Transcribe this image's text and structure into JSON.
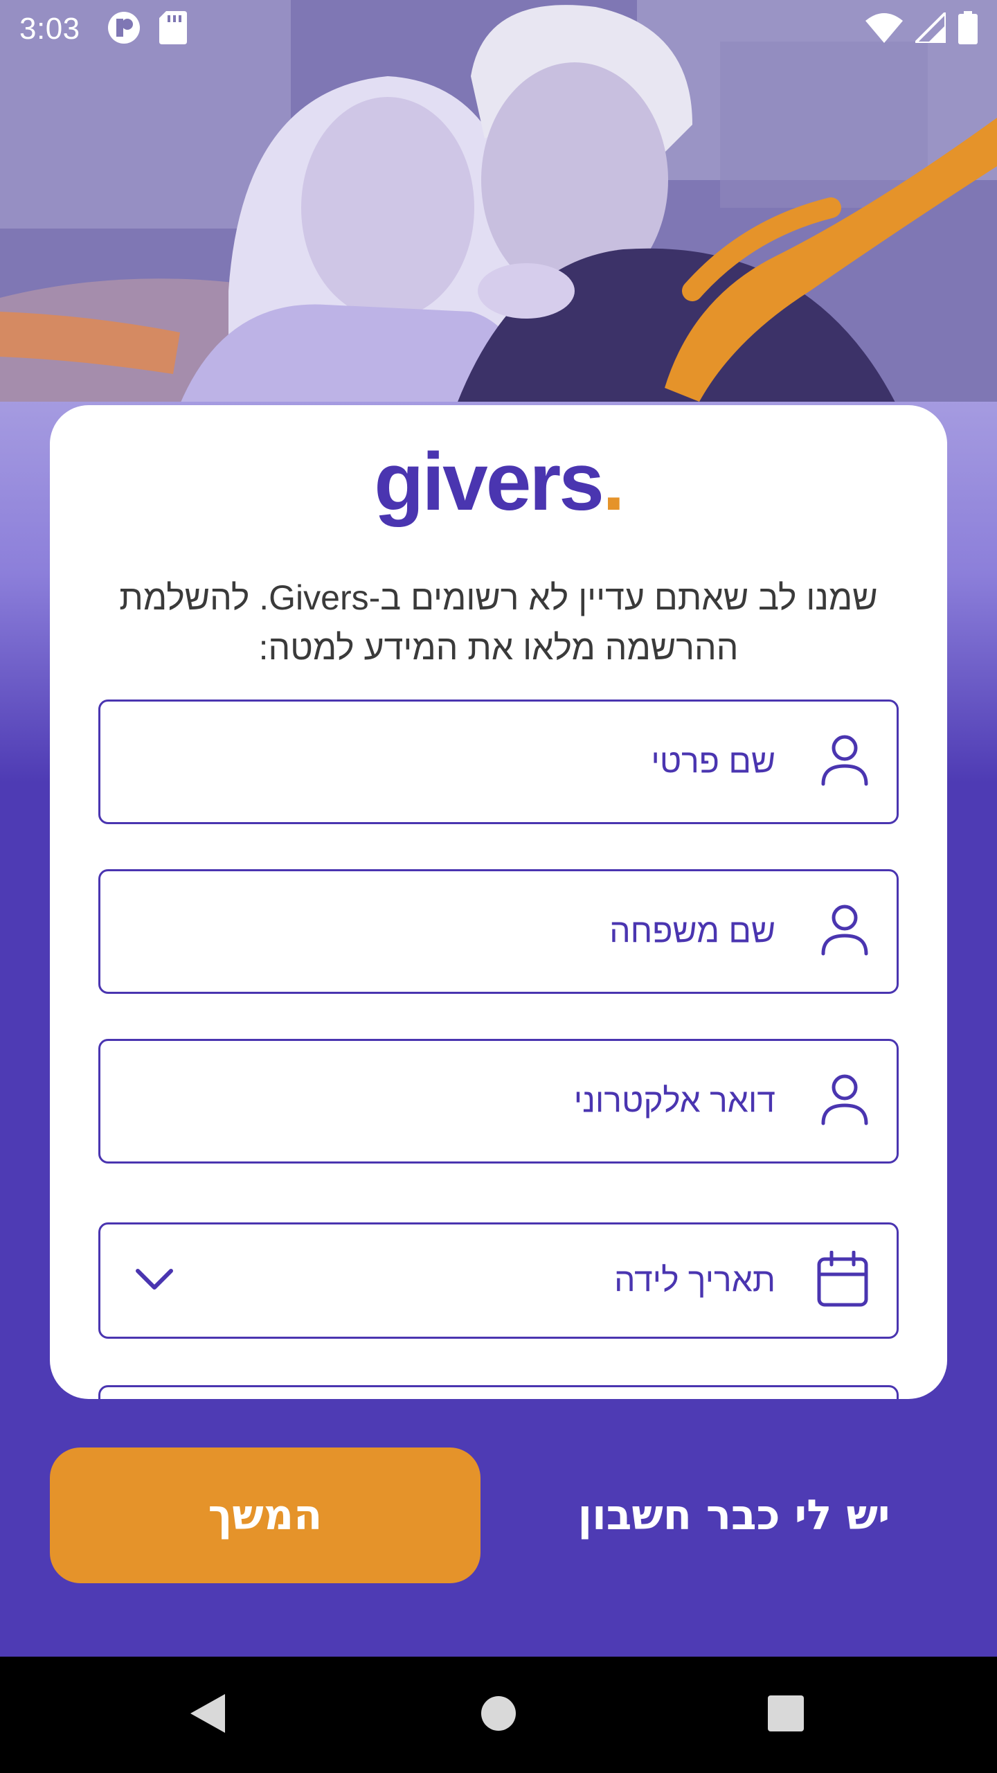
{
  "status_bar": {
    "time": "3:03",
    "icons": [
      "app-notification-icon",
      "sd-card-icon",
      "wifi-icon",
      "cellular-signal-icon",
      "battery-icon"
    ]
  },
  "brand": {
    "logo_text": "givers",
    "logo_dot": ".",
    "primary_color": "#4a35b0",
    "accent_color": "#e5932a",
    "background_color": "#4e3bb4"
  },
  "signup": {
    "intro_text": "שמנו לב שאתם עדיין לא רשומים ב-Givers. להשלמת ההרשמה מלאו את המידע למטה:",
    "fields": [
      {
        "label": "שם פרטי",
        "icon": "person-icon"
      },
      {
        "label": "שם משפחה",
        "icon": "person-icon"
      },
      {
        "label": "דואר אלקטרוני",
        "icon": "person-icon"
      },
      {
        "label": "תאריך לידה",
        "icon": "calendar-icon",
        "dropdown": "chevron-down-icon"
      }
    ]
  },
  "actions": {
    "continue_label": "המשך",
    "have_account_label": "יש לי כבר חשבון"
  },
  "nav_bar": {
    "icons": [
      "back-icon",
      "home-icon",
      "recents-icon"
    ]
  }
}
